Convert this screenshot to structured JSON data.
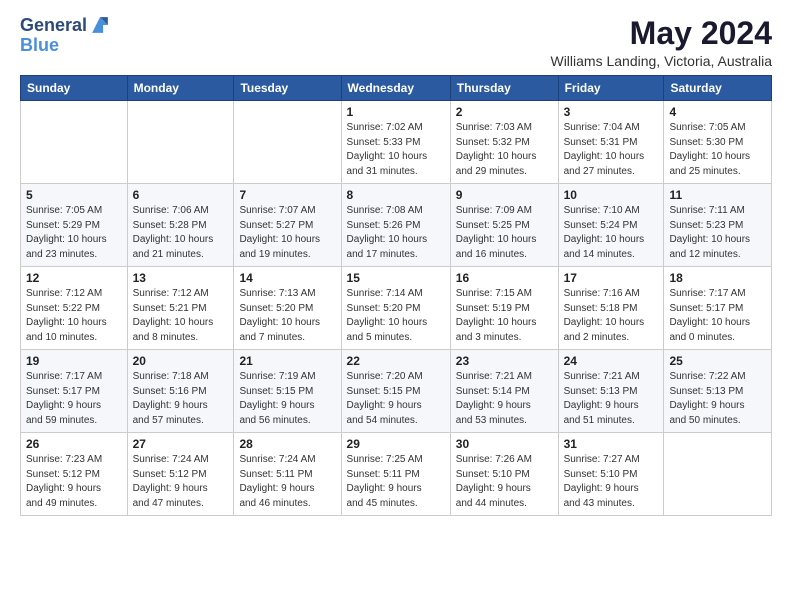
{
  "header": {
    "logo_line1": "General",
    "logo_line2": "Blue",
    "month_year": "May 2024",
    "location": "Williams Landing, Victoria, Australia"
  },
  "days_of_week": [
    "Sunday",
    "Monday",
    "Tuesday",
    "Wednesday",
    "Thursday",
    "Friday",
    "Saturday"
  ],
  "weeks": [
    [
      {
        "day": "",
        "info": ""
      },
      {
        "day": "",
        "info": ""
      },
      {
        "day": "",
        "info": ""
      },
      {
        "day": "1",
        "info": "Sunrise: 7:02 AM\nSunset: 5:33 PM\nDaylight: 10 hours\nand 31 minutes."
      },
      {
        "day": "2",
        "info": "Sunrise: 7:03 AM\nSunset: 5:32 PM\nDaylight: 10 hours\nand 29 minutes."
      },
      {
        "day": "3",
        "info": "Sunrise: 7:04 AM\nSunset: 5:31 PM\nDaylight: 10 hours\nand 27 minutes."
      },
      {
        "day": "4",
        "info": "Sunrise: 7:05 AM\nSunset: 5:30 PM\nDaylight: 10 hours\nand 25 minutes."
      }
    ],
    [
      {
        "day": "5",
        "info": "Sunrise: 7:05 AM\nSunset: 5:29 PM\nDaylight: 10 hours\nand 23 minutes."
      },
      {
        "day": "6",
        "info": "Sunrise: 7:06 AM\nSunset: 5:28 PM\nDaylight: 10 hours\nand 21 minutes."
      },
      {
        "day": "7",
        "info": "Sunrise: 7:07 AM\nSunset: 5:27 PM\nDaylight: 10 hours\nand 19 minutes."
      },
      {
        "day": "8",
        "info": "Sunrise: 7:08 AM\nSunset: 5:26 PM\nDaylight: 10 hours\nand 17 minutes."
      },
      {
        "day": "9",
        "info": "Sunrise: 7:09 AM\nSunset: 5:25 PM\nDaylight: 10 hours\nand 16 minutes."
      },
      {
        "day": "10",
        "info": "Sunrise: 7:10 AM\nSunset: 5:24 PM\nDaylight: 10 hours\nand 14 minutes."
      },
      {
        "day": "11",
        "info": "Sunrise: 7:11 AM\nSunset: 5:23 PM\nDaylight: 10 hours\nand 12 minutes."
      }
    ],
    [
      {
        "day": "12",
        "info": "Sunrise: 7:12 AM\nSunset: 5:22 PM\nDaylight: 10 hours\nand 10 minutes."
      },
      {
        "day": "13",
        "info": "Sunrise: 7:12 AM\nSunset: 5:21 PM\nDaylight: 10 hours\nand 8 minutes."
      },
      {
        "day": "14",
        "info": "Sunrise: 7:13 AM\nSunset: 5:20 PM\nDaylight: 10 hours\nand 7 minutes."
      },
      {
        "day": "15",
        "info": "Sunrise: 7:14 AM\nSunset: 5:20 PM\nDaylight: 10 hours\nand 5 minutes."
      },
      {
        "day": "16",
        "info": "Sunrise: 7:15 AM\nSunset: 5:19 PM\nDaylight: 10 hours\nand 3 minutes."
      },
      {
        "day": "17",
        "info": "Sunrise: 7:16 AM\nSunset: 5:18 PM\nDaylight: 10 hours\nand 2 minutes."
      },
      {
        "day": "18",
        "info": "Sunrise: 7:17 AM\nSunset: 5:17 PM\nDaylight: 10 hours\nand 0 minutes."
      }
    ],
    [
      {
        "day": "19",
        "info": "Sunrise: 7:17 AM\nSunset: 5:17 PM\nDaylight: 9 hours\nand 59 minutes."
      },
      {
        "day": "20",
        "info": "Sunrise: 7:18 AM\nSunset: 5:16 PM\nDaylight: 9 hours\nand 57 minutes."
      },
      {
        "day": "21",
        "info": "Sunrise: 7:19 AM\nSunset: 5:15 PM\nDaylight: 9 hours\nand 56 minutes."
      },
      {
        "day": "22",
        "info": "Sunrise: 7:20 AM\nSunset: 5:15 PM\nDaylight: 9 hours\nand 54 minutes."
      },
      {
        "day": "23",
        "info": "Sunrise: 7:21 AM\nSunset: 5:14 PM\nDaylight: 9 hours\nand 53 minutes."
      },
      {
        "day": "24",
        "info": "Sunrise: 7:21 AM\nSunset: 5:13 PM\nDaylight: 9 hours\nand 51 minutes."
      },
      {
        "day": "25",
        "info": "Sunrise: 7:22 AM\nSunset: 5:13 PM\nDaylight: 9 hours\nand 50 minutes."
      }
    ],
    [
      {
        "day": "26",
        "info": "Sunrise: 7:23 AM\nSunset: 5:12 PM\nDaylight: 9 hours\nand 49 minutes."
      },
      {
        "day": "27",
        "info": "Sunrise: 7:24 AM\nSunset: 5:12 PM\nDaylight: 9 hours\nand 47 minutes."
      },
      {
        "day": "28",
        "info": "Sunrise: 7:24 AM\nSunset: 5:11 PM\nDaylight: 9 hours\nand 46 minutes."
      },
      {
        "day": "29",
        "info": "Sunrise: 7:25 AM\nSunset: 5:11 PM\nDaylight: 9 hours\nand 45 minutes."
      },
      {
        "day": "30",
        "info": "Sunrise: 7:26 AM\nSunset: 5:10 PM\nDaylight: 9 hours\nand 44 minutes."
      },
      {
        "day": "31",
        "info": "Sunrise: 7:27 AM\nSunset: 5:10 PM\nDaylight: 9 hours\nand 43 minutes."
      },
      {
        "day": "",
        "info": ""
      }
    ]
  ]
}
